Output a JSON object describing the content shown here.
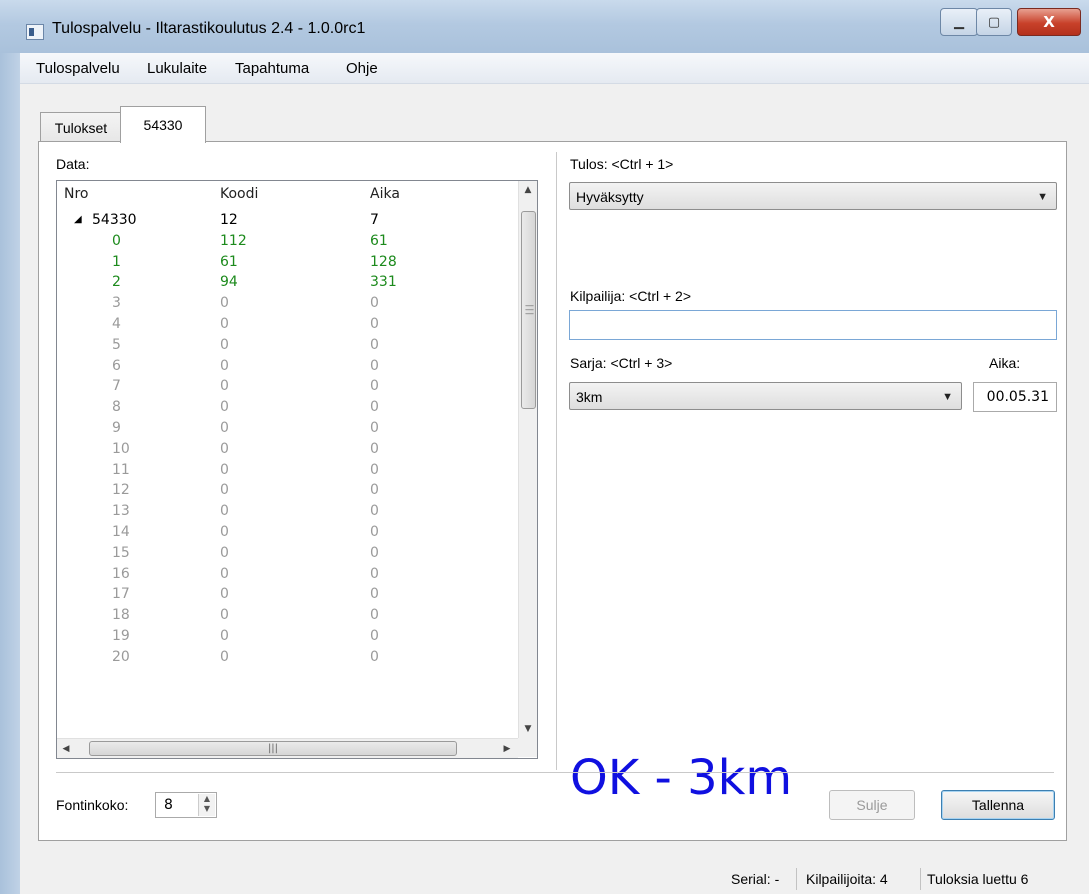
{
  "window": {
    "title": "Tulospalvelu - Iltarastikoulutus 2.4 - 1.0.0rc1",
    "min_glyph": "▁",
    "max_glyph": "▢",
    "close_glyph": "X"
  },
  "menu": [
    "Tulospalvelu",
    "Lukulaite",
    "Tapahtuma",
    "Ohje"
  ],
  "tabs": [
    {
      "label": "Tulokset",
      "active": false
    },
    {
      "label": "54330",
      "active": true
    }
  ],
  "data_panel": {
    "label": "Data:",
    "columns": [
      "Nro",
      "Koodi",
      "Aika"
    ],
    "root": {
      "nro": "54330",
      "koodi": "12",
      "aika": "7"
    },
    "rows": [
      [
        "0",
        "112",
        "61"
      ],
      [
        "1",
        "61",
        "128"
      ],
      [
        "2",
        "94",
        "331"
      ],
      [
        "3",
        "0",
        "0"
      ],
      [
        "4",
        "0",
        "0"
      ],
      [
        "5",
        "0",
        "0"
      ],
      [
        "6",
        "0",
        "0"
      ],
      [
        "7",
        "0",
        "0"
      ],
      [
        "8",
        "0",
        "0"
      ],
      [
        "9",
        "0",
        "0"
      ],
      [
        "10",
        "0",
        "0"
      ],
      [
        "11",
        "0",
        "0"
      ],
      [
        "12",
        "0",
        "0"
      ],
      [
        "13",
        "0",
        "0"
      ],
      [
        "14",
        "0",
        "0"
      ],
      [
        "15",
        "0",
        "0"
      ],
      [
        "16",
        "0",
        "0"
      ],
      [
        "17",
        "0",
        "0"
      ],
      [
        "18",
        "0",
        "0"
      ],
      [
        "19",
        "0",
        "0"
      ],
      [
        "20",
        "0",
        "0"
      ]
    ],
    "filled_count": 3
  },
  "form": {
    "tulos_label": "Tulos: <Ctrl + 1>",
    "tulos_value": "Hyväksytty",
    "kilpailija_label": "Kilpailija: <Ctrl + 2>",
    "kilpailija_value": "",
    "sarja_label": "Sarja: <Ctrl + 3>",
    "sarja_value": "3km",
    "aika_label": "Aika:",
    "aika_value": "00.05.31",
    "status_text": "OK - 3km"
  },
  "footer": {
    "font_label": "Fontinkoko:",
    "font_value": "8",
    "close_button": "Sulje",
    "save_button": "Tallenna"
  },
  "statusbar": {
    "serial": "Serial: -",
    "competitors": "Kilpailijoita: 4",
    "results": "Tuloksia luettu 6"
  },
  "colors": {
    "filled_row": "#1c8a1c",
    "empty_row": "#9a9a9a",
    "status_text": "#1010e0"
  }
}
